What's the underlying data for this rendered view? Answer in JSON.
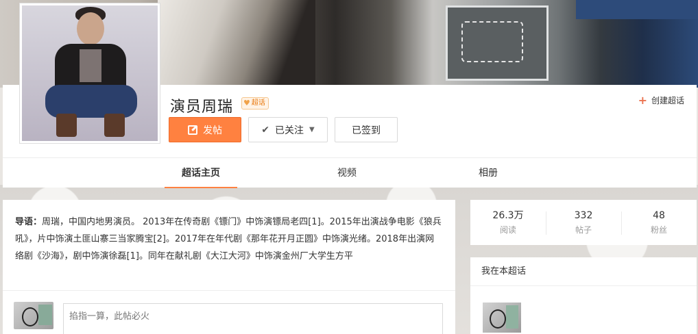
{
  "profile": {
    "name": "演员周瑞",
    "badge": "超话",
    "create_link": "创建超话"
  },
  "actions": {
    "post": "发帖",
    "follow": "已关注",
    "signed_in": "已签到"
  },
  "tabs": [
    {
      "label": "超话主页",
      "active": true
    },
    {
      "label": "视频",
      "active": false
    },
    {
      "label": "相册",
      "active": false
    }
  ],
  "intro": {
    "label": "导语：",
    "text": "周瑞，中国内地男演员。 2013年在传奇剧《镖门》中饰演镖局老四[1]。2015年出演战争电影《狼兵吼》，片中饰演土匪山寨三当家腾宝[2]。2017年在年代剧《那年花开月正圆》中饰演光绪。2018年出演网络剧《沙海》，剧中饰演徐磊[1]。同年在献礼剧《大江大河》中饰演金州厂大学生方平"
  },
  "compose": {
    "placeholder": "掐指一算，此帖必火"
  },
  "stats": [
    {
      "value": "26.3万",
      "label": "阅读"
    },
    {
      "value": "332",
      "label": "帖子"
    },
    {
      "value": "48",
      "label": "粉丝"
    }
  ],
  "me_section": {
    "title": "我在本超话"
  },
  "colors": {
    "accent": "#ff8140",
    "badge": "#e8790f"
  }
}
